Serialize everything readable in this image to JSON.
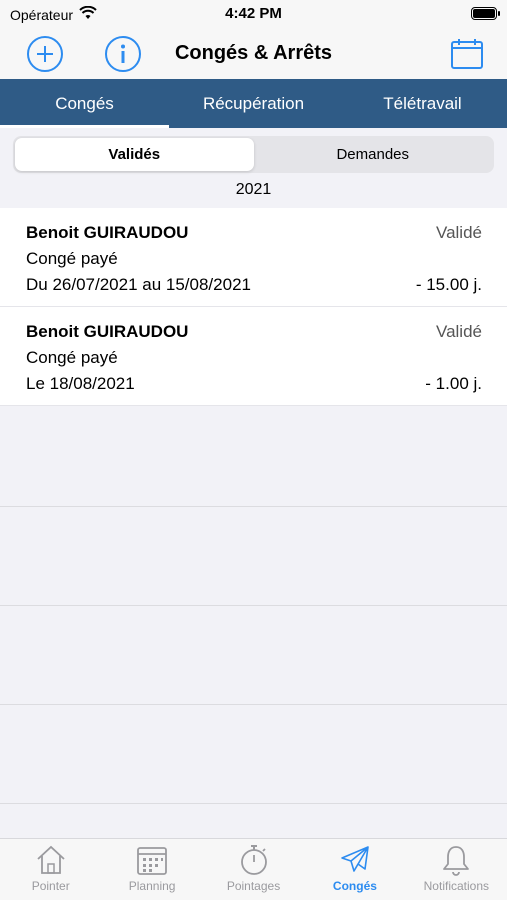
{
  "status_bar": {
    "carrier": "Opérateur",
    "time": "4:42 PM",
    "battery_level": 1.0
  },
  "header": {
    "title": "Congés & Arrêts",
    "add_icon": "plus-circle-icon",
    "info_icon": "info-circle-icon",
    "calendar_icon": "calendar-icon",
    "accent_color": "#2d8cf0"
  },
  "tabs": [
    {
      "label": "Congés",
      "active": true
    },
    {
      "label": "Récupération",
      "active": false
    },
    {
      "label": "Télétravail",
      "active": false
    }
  ],
  "tab_color": "#2f5b86",
  "segments": [
    {
      "label": "Validés",
      "selected": true
    },
    {
      "label": "Demandes",
      "selected": false
    }
  ],
  "year": "2021",
  "entries": [
    {
      "name": "Benoit GUIRAUDOU",
      "status": "Validé",
      "type": "Congé payé",
      "period": "Du 26/07/2021 au 15/08/2021",
      "days": "- 15.00 j."
    },
    {
      "name": "Benoit GUIRAUDOU",
      "status": "Validé",
      "type": "Congé payé",
      "period": "Le 18/08/2021",
      "days": "- 1.00 j."
    }
  ],
  "tabbar": [
    {
      "label": "Pointer",
      "icon": "house-icon",
      "active": false
    },
    {
      "label": "Planning",
      "icon": "calendar-grid-icon",
      "active": false
    },
    {
      "label": "Pointages",
      "icon": "stopwatch-icon",
      "active": false
    },
    {
      "label": "Congés",
      "icon": "airplane-icon",
      "active": true
    },
    {
      "label": "Notifications",
      "icon": "bell-icon",
      "active": false
    }
  ]
}
